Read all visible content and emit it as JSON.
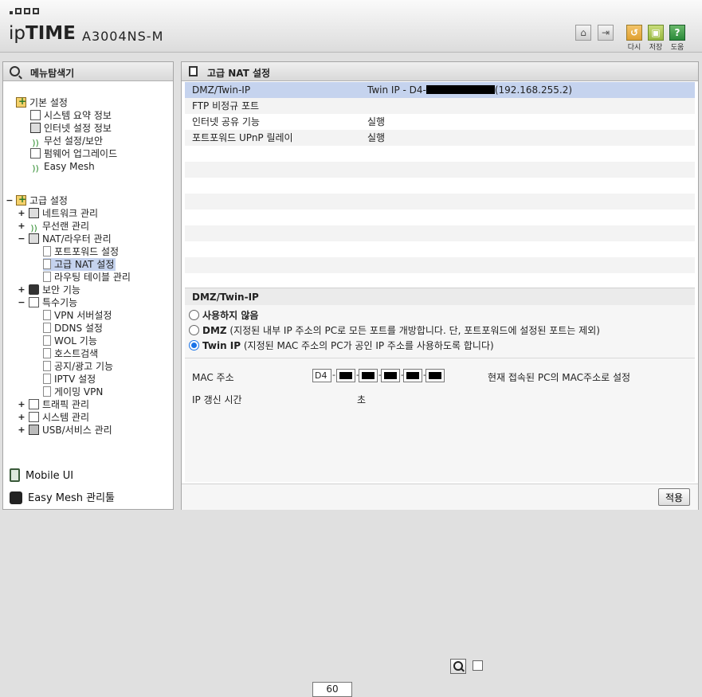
{
  "header": {
    "model": "A3004NS-M",
    "brand_ip": "ip",
    "brand_time": "TIME",
    "buttons": {
      "restart": "다시",
      "save": "저장",
      "help": "도움"
    }
  },
  "left": {
    "title": "메뉴탐색기",
    "basic": {
      "label": "기본 설정",
      "items": [
        "시스템 요약 정보",
        "인터넷 설정 정보",
        "무선 설정/보안",
        "펌웨어 업그레이드",
        "Easy Mesh"
      ]
    },
    "advanced": {
      "label": "고급 설정",
      "items": [
        {
          "label": "네트워크 관리",
          "exp": "+"
        },
        {
          "label": "무선랜 관리",
          "exp": "+"
        },
        {
          "label": "NAT/라우터 관리",
          "exp": "−"
        },
        {
          "label": "포트포워드 설정"
        },
        {
          "label": "고급 NAT 설정"
        },
        {
          "label": "라우팅 테이블 관리"
        },
        {
          "label": "보안 기능",
          "exp": "+"
        },
        {
          "label": "특수기능",
          "exp": "−"
        },
        {
          "label": "VPN 서버설정"
        },
        {
          "label": "DDNS 설정"
        },
        {
          "label": "WOL 기능"
        },
        {
          "label": "호스트검색"
        },
        {
          "label": "공지/광고 기능"
        },
        {
          "label": "IPTV 설정"
        },
        {
          "label": "게이밍 VPN"
        },
        {
          "label": "트래픽 관리",
          "exp": "+"
        },
        {
          "label": "시스템 관리",
          "exp": "+"
        },
        {
          "label": "USB/서비스 관리",
          "exp": "+"
        }
      ]
    },
    "mobile": "Mobile UI",
    "mesh": "Easy Mesh 관리툴"
  },
  "main": {
    "title": "고급 NAT 설정",
    "rows": [
      {
        "key": "DMZ/Twin-IP",
        "prefix": "Twin IP - D4-",
        "suffix": "(192.168.255.2)"
      },
      {
        "key": "FTP 비정규 포트",
        "value": ""
      },
      {
        "key": "인터넷 공유 기능",
        "value": "실행"
      },
      {
        "key": "포트포워드 UPnP 릴레이",
        "value": "실행"
      }
    ],
    "section": "DMZ/Twin-IP",
    "options": [
      {
        "label": "사용하지 않음",
        "desc": "",
        "checked": false
      },
      {
        "label": "DMZ",
        "desc": " (지정된 내부 IP 주소의 PC로 모든 포트를 개방합니다. 단, 포트포워드에 설정된 포트는 제외)",
        "checked": false
      },
      {
        "label": "Twin IP",
        "desc": " (지정된 MAC 주소의 PC가 공인 IP 주소를 사용하도록 합니다)",
        "checked": true
      }
    ],
    "mac_label": "MAC 주소",
    "mac_first": "D4",
    "mac_checkbox": "현재 접속된 PC의 MAC주소로 설정",
    "renew_label": "IP 갱신 시간",
    "renew_value": "60",
    "renew_unit": "초",
    "apply": "적용"
  }
}
